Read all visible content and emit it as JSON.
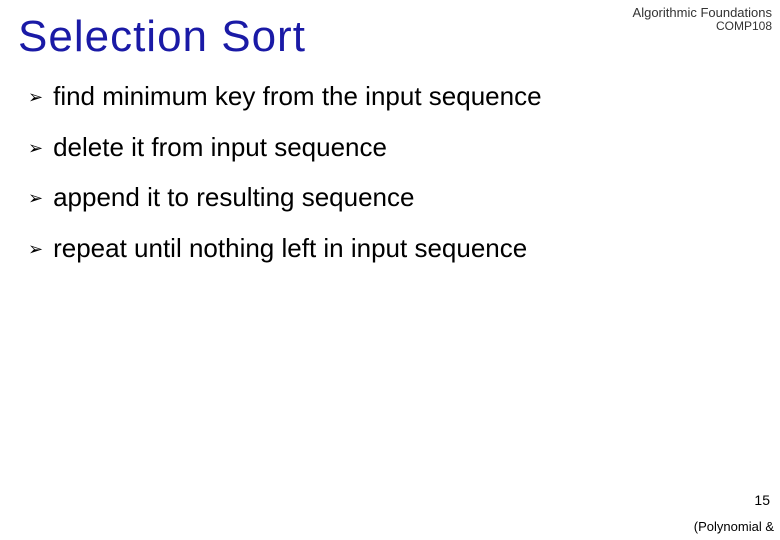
{
  "header": {
    "line1": "Algorithmic Foundations",
    "line2": "COMP108"
  },
  "title": "Selection Sort",
  "bullets": [
    "find minimum key from the input sequence",
    "delete it from input sequence",
    "append it to resulting sequence",
    "repeat until nothing left in input sequence"
  ],
  "page_number": "15",
  "footer_note": "(Polynomial &"
}
